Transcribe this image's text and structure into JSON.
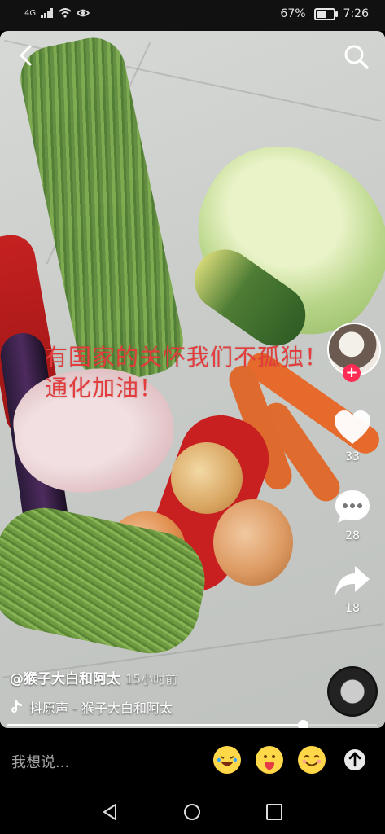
{
  "status_bar": {
    "network_label": "4G",
    "battery_percent": "67%",
    "battery_level": 0.67,
    "time": "7:26"
  },
  "video": {
    "caption_overlay": "有国家的关怀我们不孤独！通化加油！",
    "author": "@猴子大白和阿太",
    "time_ago": "15小时前",
    "music": "抖原声 - 猴子大白和阿太",
    "progress": 0.8
  },
  "actions": {
    "likes": "33",
    "comments": "28",
    "shares": "18"
  },
  "comment_bar": {
    "placeholder": "我想说..."
  },
  "icons": {
    "back": "back-arrow-icon",
    "search": "search-icon",
    "like": "heart-icon",
    "comment": "comment-bubble-icon",
    "share": "share-arrow-icon",
    "music": "tiktok-note-icon",
    "nav_back": "triangle-back-icon",
    "nav_home": "circle-home-icon",
    "nav_recent": "square-recent-icon"
  },
  "colors": {
    "follow_accent": "#fe2c55",
    "overlay_text": "#e43c3c"
  }
}
